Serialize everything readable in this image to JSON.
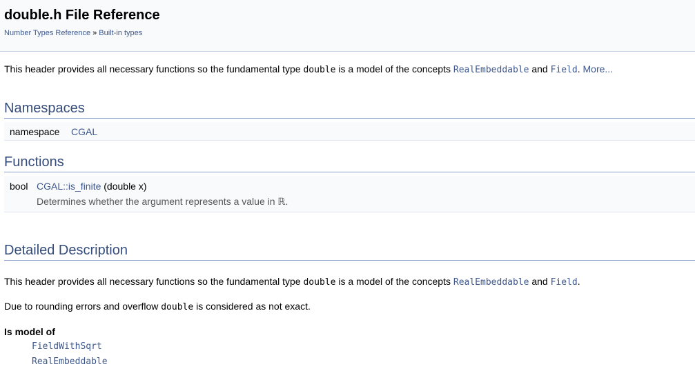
{
  "header": {
    "title": "double.h File Reference",
    "breadcrumb": {
      "items": [
        "Number Types Reference",
        "Built-in types"
      ],
      "separator": "»"
    }
  },
  "summary": {
    "text_before": "This header provides all necessary functions so the fundamental type ",
    "type_name": "double",
    "text_mid": " is a model of the concepts ",
    "concept1": "RealEmbeddable",
    "and": " and ",
    "concept2": "Field",
    "period": ".",
    "more_link": " More..."
  },
  "namespaces": {
    "title": "Namespaces",
    "rows": [
      {
        "keyword": "namespace",
        "name": "CGAL"
      }
    ]
  },
  "functions": {
    "title": "Functions",
    "rows": [
      {
        "return_type": "bool",
        "name": "CGAL::is_finite",
        "params": " (double x)",
        "brief_prefix": "Determines whether the argument represents a value in ",
        "brief_symbol": "ℝ",
        "brief_suffix": "."
      }
    ]
  },
  "detailed": {
    "title": "Detailed Description",
    "para1": {
      "text_before": "This header provides all necessary functions so the fundamental type ",
      "type_name": "double",
      "text_mid": " is a model of the concepts ",
      "concept1": "RealEmbeddable",
      "and": " and ",
      "concept2": "Field",
      "period": "."
    },
    "para2": {
      "text_before": "Due to rounding errors and overflow ",
      "type_name": "double",
      "text_after": " is considered as not exact."
    },
    "model_of": {
      "title": "Is model of",
      "items": [
        "FieldWithSqrt",
        "RealEmbeddable"
      ]
    }
  },
  "colors": {
    "link": "#3d578c",
    "section_title": "#354c7b",
    "header_bg": "#f9fafc",
    "row_bg": "#f9fafc"
  }
}
